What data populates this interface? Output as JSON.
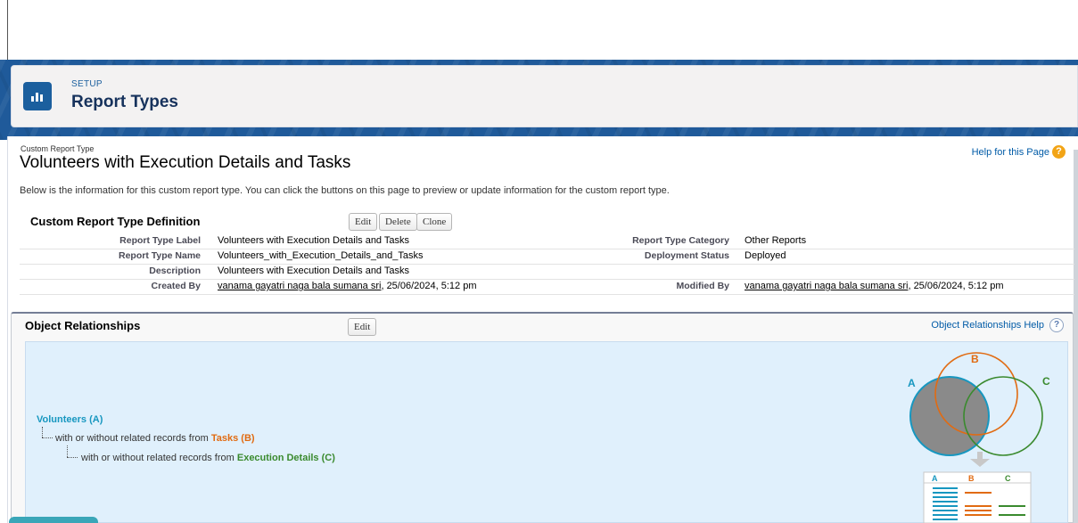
{
  "header": {
    "setup_label": "SETUP",
    "title": "Report Types",
    "icon": "bar-chart-icon"
  },
  "report": {
    "kind": "Custom Report Type",
    "title": "Volunteers with Execution Details and Tasks",
    "help_link": "Help for this Page",
    "intro": "Below is the information for this custom report type. You can click the buttons on this page to preview or update information for the custom report type."
  },
  "definition": {
    "section_title": "Custom Report Type Definition",
    "buttons": {
      "edit": "Edit",
      "delete": "Delete",
      "clone": "Clone"
    },
    "rows": {
      "label_label": "Report Type Label",
      "label_value": "Volunteers with Execution Details and Tasks",
      "category_label": "Report Type Category",
      "category_value": "Other Reports",
      "name_label": "Report Type Name",
      "name_value": "Volunteers_with_Execution_Details_and_Tasks",
      "status_label": "Deployment Status",
      "status_value": "Deployed",
      "description_label": "Description",
      "description_value": "Volunteers with Execution Details and Tasks",
      "created_label": "Created By",
      "created_user": "vanama gayatri naga bala sumana sri",
      "created_time": ", 25/06/2024, 5:12 pm",
      "modified_label": "Modified By",
      "modified_user": "vanama gayatri naga bala sumana sri",
      "modified_time": ", 25/06/2024, 5:12 pm"
    }
  },
  "relationships": {
    "section_title": "Object Relationships",
    "edit_button": "Edit",
    "help_link": "Object Relationships Help",
    "primary": "Volunteers (A)",
    "with_text": "with or without related records from ",
    "object_b": "Tasks (B)",
    "object_c": "Execution Details (C)",
    "venn_labels": {
      "a": "A",
      "b": "B",
      "c": "C"
    },
    "colors": {
      "a": "#1797c0",
      "b": "#e16b12",
      "c": "#3a8a2e"
    }
  }
}
